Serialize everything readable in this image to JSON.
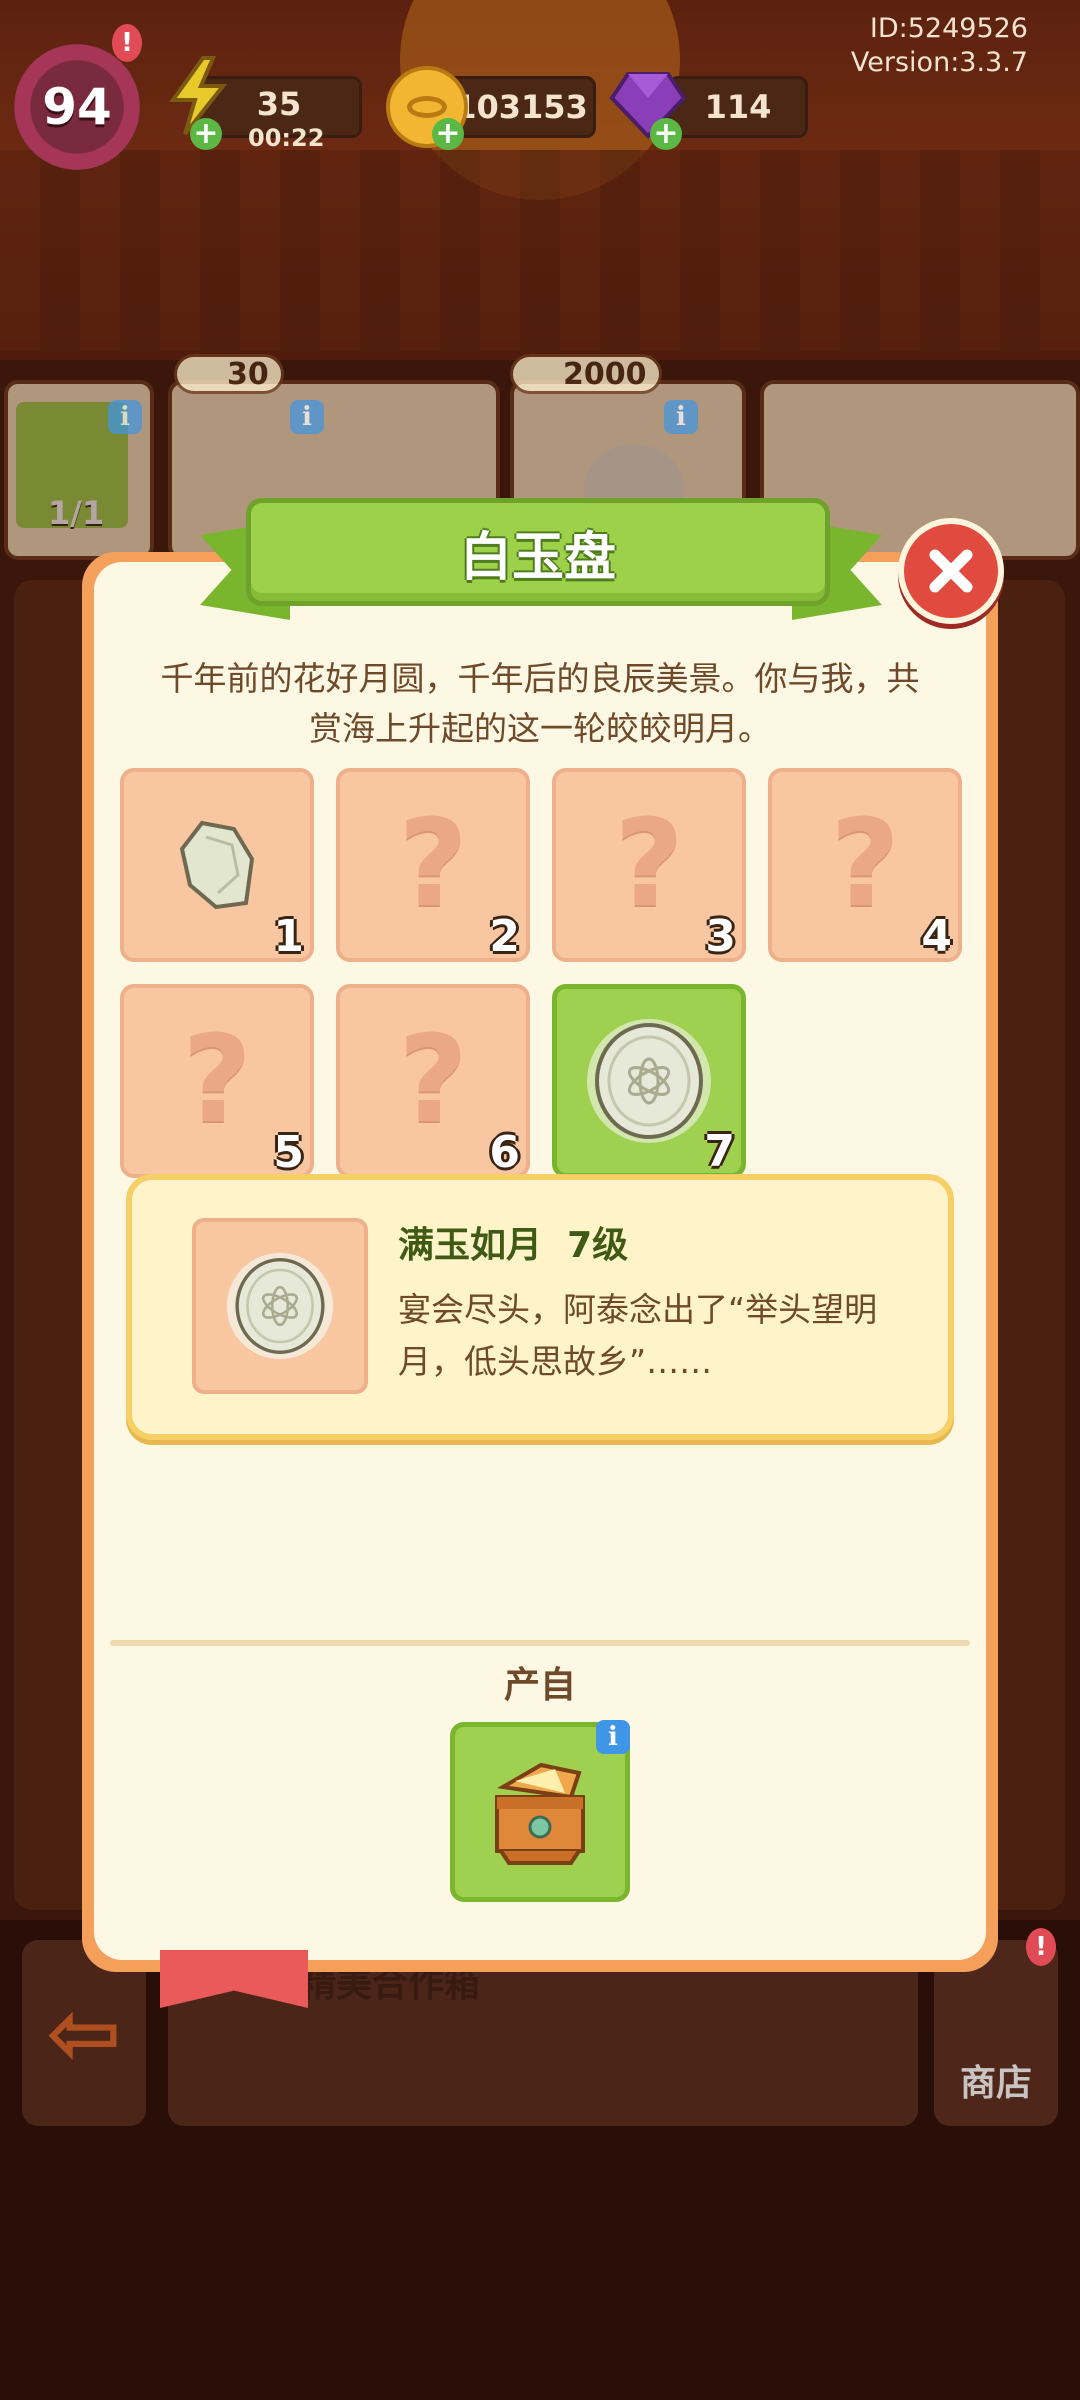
{
  "hud": {
    "level": "94",
    "level_alert": "!",
    "energy": "35",
    "energy_timer": "00:22",
    "coins": "103153",
    "gems": "114",
    "player_id": "ID:5249526",
    "version": "Version:3.3.7"
  },
  "shelf": {
    "card1_count": "1/1",
    "card2_price": "30",
    "card3_price": "2000"
  },
  "modal": {
    "title": "白玉盘",
    "description": "千年前的花好月圆，千年后的良辰美景。你与我，共赏海上升起的这一轮皎皎明月。",
    "cells": [
      {
        "num": "1",
        "state": "unlocked"
      },
      {
        "num": "2",
        "state": "locked"
      },
      {
        "num": "3",
        "state": "locked"
      },
      {
        "num": "4",
        "state": "locked"
      },
      {
        "num": "5",
        "state": "locked"
      },
      {
        "num": "6",
        "state": "locked"
      },
      {
        "num": "7",
        "state": "selected"
      }
    ],
    "detail": {
      "name": "满玉如月  7级",
      "text": "宴会尽头，阿泰念出了“举头望明月，低头思故乡”……"
    },
    "source_label": "产自"
  },
  "bottom": {
    "shop_label": "商店",
    "panel_text": "精美合作箱"
  },
  "colors": {
    "modal_bg": "#fdf8e4",
    "banner_green": "#9dd14a",
    "close_red": "#e14b3f",
    "locked_cell": "#f8c6a0",
    "active_cell": "#9fd04f"
  }
}
